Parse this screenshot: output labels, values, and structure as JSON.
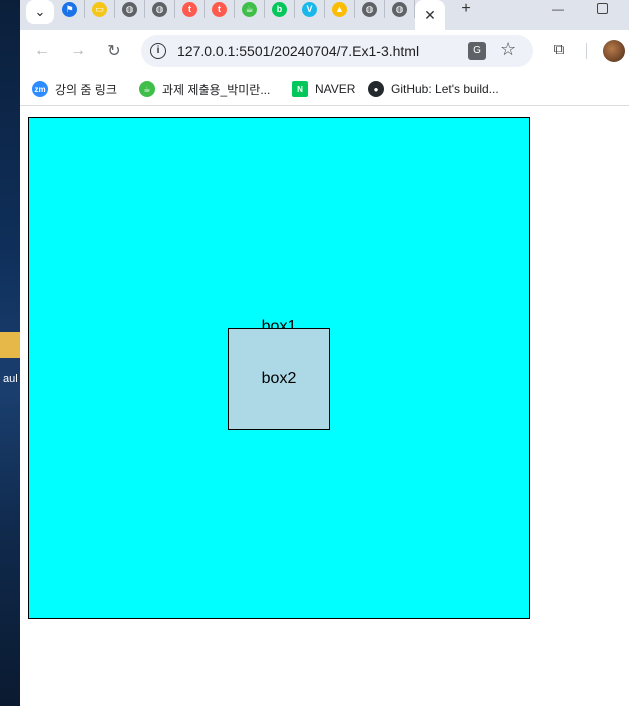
{
  "window": {
    "new_tab_label": "+",
    "close_label": "✕",
    "menu_label": "⌄",
    "minimize_label": "—"
  },
  "tabs": [
    {
      "icon": "flag-icon",
      "color": "#1a73e8",
      "glyph": "⚑"
    },
    {
      "icon": "imdb-icon",
      "color": "#f5c518",
      "glyph": "▭"
    },
    {
      "icon": "globe-icon",
      "color": "#5f6368",
      "glyph": "◍"
    },
    {
      "icon": "globe-icon",
      "color": "#5f6368",
      "glyph": "◍"
    },
    {
      "icon": "red-app-icon",
      "color": "#ff5a4e",
      "glyph": "t"
    },
    {
      "icon": "red-app-icon",
      "color": "#ff5a4e",
      "glyph": "t"
    },
    {
      "icon": "cup-icon",
      "color": "#3fbf4a",
      "glyph": "☕"
    },
    {
      "icon": "naver-blog-icon",
      "color": "#03c75a",
      "glyph": "b"
    },
    {
      "icon": "vimeo-icon",
      "color": "#1ab7ea",
      "glyph": "V"
    },
    {
      "icon": "google-drive-icon",
      "color": "#fbbc04",
      "glyph": "▲"
    },
    {
      "icon": "globe-icon",
      "color": "#5f6368",
      "glyph": "◍"
    },
    {
      "icon": "globe-icon",
      "color": "#5f6368",
      "glyph": "◍"
    }
  ],
  "toolbar": {
    "back": "←",
    "forward": "→",
    "reload": "↻",
    "url": "127.0.0.1:5501/20240704/7.Ex1-3.html",
    "info_glyph": "i",
    "translate_glyph": "G",
    "star_glyph": "☆",
    "extensions_glyph": "⧉"
  },
  "bookmarks": [
    {
      "label": "강의 줌 링크",
      "icon": "zoom-icon",
      "color": "#2d8cff",
      "glyph": "zm"
    },
    {
      "label": "과제 제출용_박미란...",
      "icon": "cup-icon",
      "color": "#3fbf4a",
      "glyph": "☕"
    },
    {
      "label": "NAVER",
      "icon": "naver-icon",
      "color": "#03c75a",
      "glyph": "N"
    },
    {
      "label": "GitHub: Let's build...",
      "icon": "github-icon",
      "color": "#24292e",
      "glyph": "●"
    }
  ],
  "page": {
    "box1_label": "box1",
    "box2_label": "box2"
  },
  "desktop": {
    "side_text": "aul"
  }
}
